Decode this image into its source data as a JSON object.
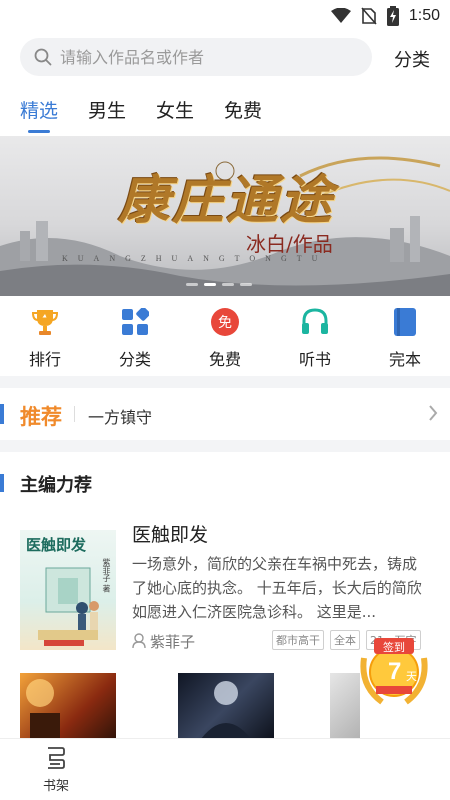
{
  "status_bar": {
    "time": "1:50",
    "icons": [
      "wifi-icon",
      "no-sim-icon",
      "battery-charging-icon"
    ]
  },
  "search": {
    "placeholder": "请输入作品名或作者",
    "category_label": "分类"
  },
  "tabs": [
    {
      "label": "精选",
      "active": true
    },
    {
      "label": "男生",
      "active": false
    },
    {
      "label": "女生",
      "active": false
    },
    {
      "label": "免费",
      "active": false
    }
  ],
  "banner": {
    "title": "康庄通途",
    "author": "冰白/作品",
    "pinyin": "KUANGZHUANGTONGTU"
  },
  "quick_nav": [
    {
      "label": "排行",
      "icon": "trophy-icon",
      "color": "#f5a623"
    },
    {
      "label": "分类",
      "icon": "grid-icon",
      "color": "#3a7bd5"
    },
    {
      "label": "免费",
      "icon": "free-icon",
      "color": "#e8473a"
    },
    {
      "label": "听书",
      "icon": "headphones-icon",
      "color": "#1bb5a0"
    },
    {
      "label": "完本",
      "icon": "book-icon",
      "color": "#3a7bd5"
    }
  ],
  "recommend": {
    "title": "推荐",
    "text": "一方镇守"
  },
  "editor_section": {
    "title": "主编力荐"
  },
  "featured_book": {
    "cover_title": "医触即发",
    "cover_author": "紫菲子 著",
    "title": "医触即发",
    "description": "一场意外，简欣的父亲在车祸中死去，铸成了她心底的执念。 十五年后，长大后的简欣如愿进入仁济医院急诊科。 这里是...",
    "author": "紫菲子",
    "tags": [
      "都市高干",
      "全本",
      "21...万字"
    ]
  },
  "badge": {
    "top": "签到",
    "main": "7",
    "unit": "天"
  },
  "bottom_nav": {
    "shelf_label": "书架"
  },
  "colors": {
    "accent": "#3a7bd5",
    "orange": "#f08a2b"
  }
}
